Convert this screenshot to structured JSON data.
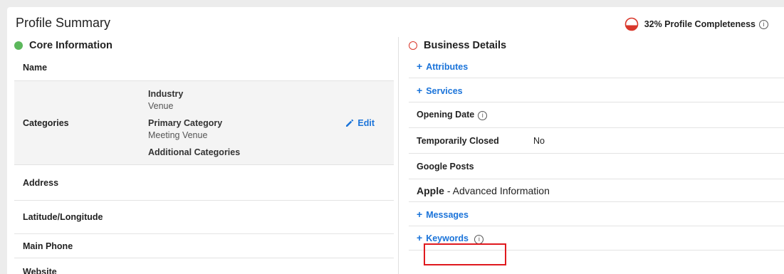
{
  "header": {
    "title": "Profile Summary",
    "completeness": "32% Profile Completeness",
    "completeness_value": 0.32,
    "accent_red": "#d9372b"
  },
  "core": {
    "title": "Core Information",
    "name_label": "Name",
    "categories_label": "Categories",
    "industry_title": "Industry",
    "industry_value": "Venue",
    "primary_title": "Primary Category",
    "primary_value": "Meeting Venue",
    "additional_title": "Additional Categories",
    "edit_label": "Edit",
    "address_label": "Address",
    "latlng_label": "Latitude/Longitude",
    "phone_label": "Main Phone",
    "website_label": "Website"
  },
  "business": {
    "title": "Business Details",
    "attributes_label": "Attributes",
    "services_label": "Services",
    "opening_date_label": "Opening Date",
    "temp_closed_label": "Temporarily Closed",
    "temp_closed_value": "No",
    "google_posts_label": "Google Posts"
  },
  "apple": {
    "brand": "Apple",
    "suffix": "- Advanced Information",
    "messages_label": "Messages",
    "keywords_label": "Keywords"
  },
  "icons": {
    "plus": "+",
    "info": "i"
  }
}
